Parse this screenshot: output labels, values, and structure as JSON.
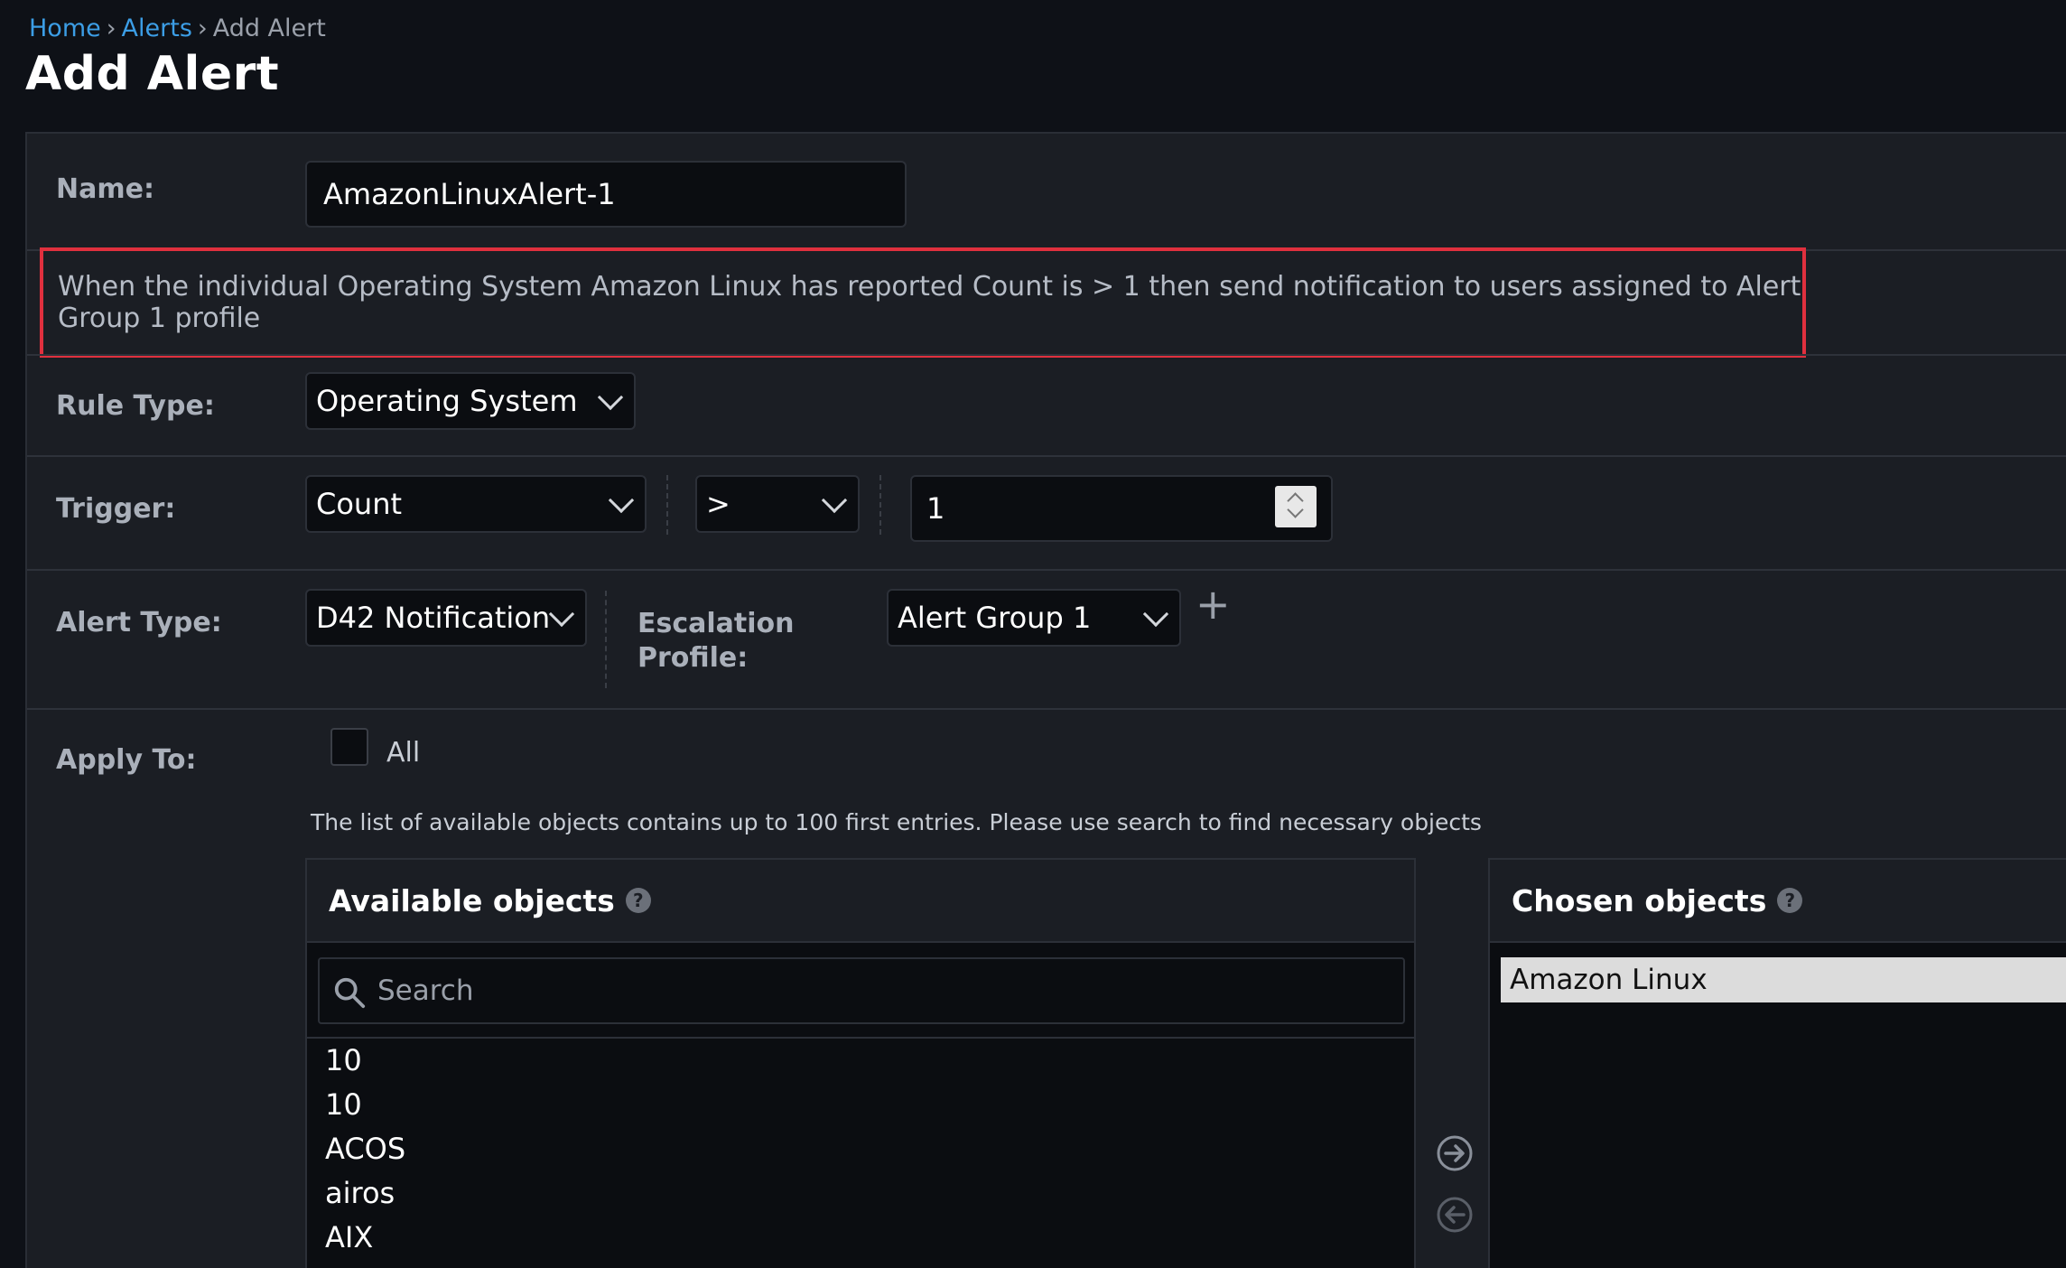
{
  "breadcrumb": {
    "home": "Home",
    "alerts": "Alerts",
    "current": "Add Alert",
    "separator": "›"
  },
  "page_title": "Add Alert",
  "name": {
    "label": "Name:",
    "value": "AmazonLinuxAlert-1"
  },
  "description": "When the individual Operating System Amazon Linux has reported Count is > 1 then send notification to users assigned to Alert Group 1 profile",
  "rule_type": {
    "label": "Rule Type:",
    "value": "Operating System"
  },
  "trigger": {
    "label": "Trigger:",
    "metric": "Count",
    "operator": ">",
    "threshold": "1"
  },
  "alert_type": {
    "label": "Alert Type:",
    "value": "D42 Notification"
  },
  "escalation": {
    "label_line1": "Escalation",
    "label_line2": "Profile:",
    "value": "Alert Group 1",
    "add_symbol": "+"
  },
  "apply_to": {
    "label": "Apply To:",
    "all_label": "All",
    "all_checked": false,
    "note": "The list of available objects contains up to 100 first entries. Please use search to find necessary objects"
  },
  "available": {
    "title": "Available objects",
    "help": "?",
    "search_placeholder": "Search",
    "items": [
      "10",
      "10",
      "ACOS",
      "airos",
      "AIX"
    ]
  },
  "chosen": {
    "title": "Chosen objects",
    "help": "?",
    "items": [
      "Amazon Linux"
    ]
  },
  "colors": {
    "accent_link": "#3c9ee6",
    "highlight_border": "#e0303e",
    "background": "#0e1117",
    "panel": "#1b1e24"
  }
}
